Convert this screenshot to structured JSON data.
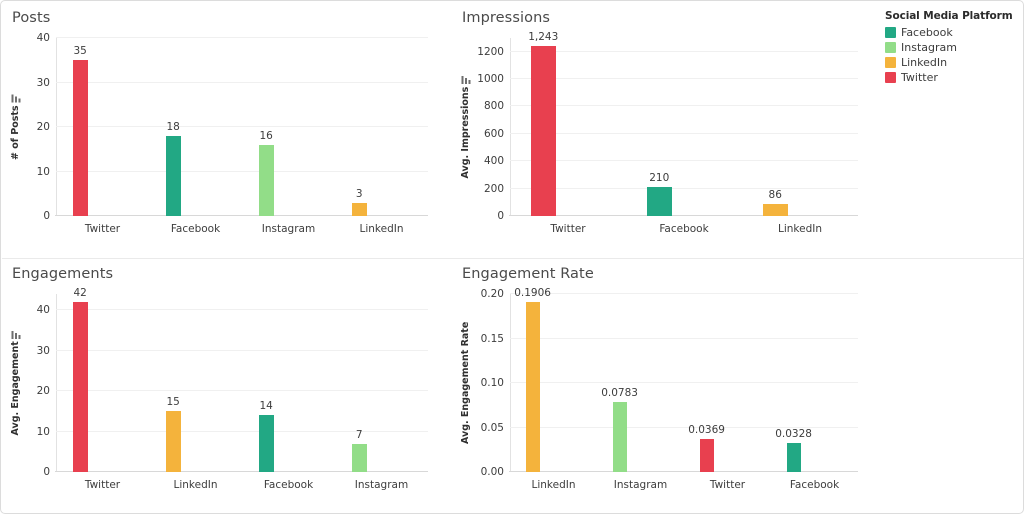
{
  "legend": {
    "title": "Social Media Platform",
    "items": [
      {
        "label": "Facebook",
        "color": "#22a884"
      },
      {
        "label": "Instagram",
        "color": "#92dd88"
      },
      {
        "label": "LinkedIn",
        "color": "#f4b33c"
      },
      {
        "label": "Twitter",
        "color": "#e8404f"
      }
    ]
  },
  "colors": {
    "Facebook": "#22a884",
    "Instagram": "#92dd88",
    "LinkedIn": "#f4b33c",
    "Twitter": "#e8404f"
  },
  "chart_data": [
    {
      "type": "bar",
      "id": "posts",
      "title": "Posts",
      "xlabel": "",
      "ylabel": "# of Posts",
      "ylabel_sort_icon": true,
      "categories": [
        "Twitter",
        "Facebook",
        "Instagram",
        "LinkedIn"
      ],
      "values": [
        35,
        18,
        16,
        3
      ],
      "value_labels": [
        "35",
        "18",
        "16",
        "3"
      ],
      "colors": [
        "#e8404f",
        "#22a884",
        "#92dd88",
        "#f4b33c"
      ],
      "ylim": [
        0,
        40
      ],
      "yticks": [
        0,
        10,
        20,
        30,
        40
      ],
      "ytick_labels": [
        "0",
        "10",
        "20",
        "30",
        "40"
      ],
      "grid": true,
      "legend_position": "none"
    },
    {
      "type": "bar",
      "id": "impressions",
      "title": "Impressions",
      "xlabel": "",
      "ylabel": "Avg. Impressions",
      "ylabel_sort_icon": true,
      "categories": [
        "Twitter",
        "Facebook",
        "LinkedIn"
      ],
      "values": [
        1243,
        210,
        86
      ],
      "value_labels": [
        "1,243",
        "210",
        "86"
      ],
      "colors": [
        "#e8404f",
        "#22a884",
        "#f4b33c"
      ],
      "ylim": [
        0,
        1300
      ],
      "yticks": [
        0,
        200,
        400,
        600,
        800,
        1000,
        1200
      ],
      "ytick_labels": [
        "0",
        "200",
        "400",
        "600",
        "800",
        "1000",
        "1200"
      ],
      "grid": true,
      "legend_position": "top-right"
    },
    {
      "type": "bar",
      "id": "engagements",
      "title": "Engagements",
      "xlabel": "",
      "ylabel": "Avg. Engagement",
      "ylabel_sort_icon": true,
      "categories": [
        "Twitter",
        "LinkedIn",
        "Facebook",
        "Instagram"
      ],
      "values": [
        42,
        15,
        14,
        7
      ],
      "value_labels": [
        "42",
        "15",
        "14",
        "7"
      ],
      "colors": [
        "#e8404f",
        "#f4b33c",
        "#22a884",
        "#92dd88"
      ],
      "ylim": [
        0,
        44
      ],
      "yticks": [
        0,
        10,
        20,
        30,
        40
      ],
      "ytick_labels": [
        "0",
        "10",
        "20",
        "30",
        "40"
      ],
      "grid": true,
      "legend_position": "none"
    },
    {
      "type": "bar",
      "id": "engagement-rate",
      "title": "Engagement Rate",
      "xlabel": "",
      "ylabel": "Avg. Engagement Rate",
      "ylabel_sort_icon": false,
      "categories": [
        "LinkedIn",
        "Instagram",
        "Twitter",
        "Facebook"
      ],
      "values": [
        0.1906,
        0.0783,
        0.0369,
        0.0328
      ],
      "value_labels": [
        "0.1906",
        "0.0783",
        "0.0369",
        "0.0328"
      ],
      "colors": [
        "#f4b33c",
        "#92dd88",
        "#e8404f",
        "#22a884"
      ],
      "ylim": [
        0,
        0.2
      ],
      "yticks": [
        0,
        0.05,
        0.1,
        0.15,
        0.2
      ],
      "ytick_labels": [
        "0.00",
        "0.05",
        "0.10",
        "0.15",
        "0.20"
      ],
      "grid": true,
      "legend_position": "none"
    }
  ]
}
